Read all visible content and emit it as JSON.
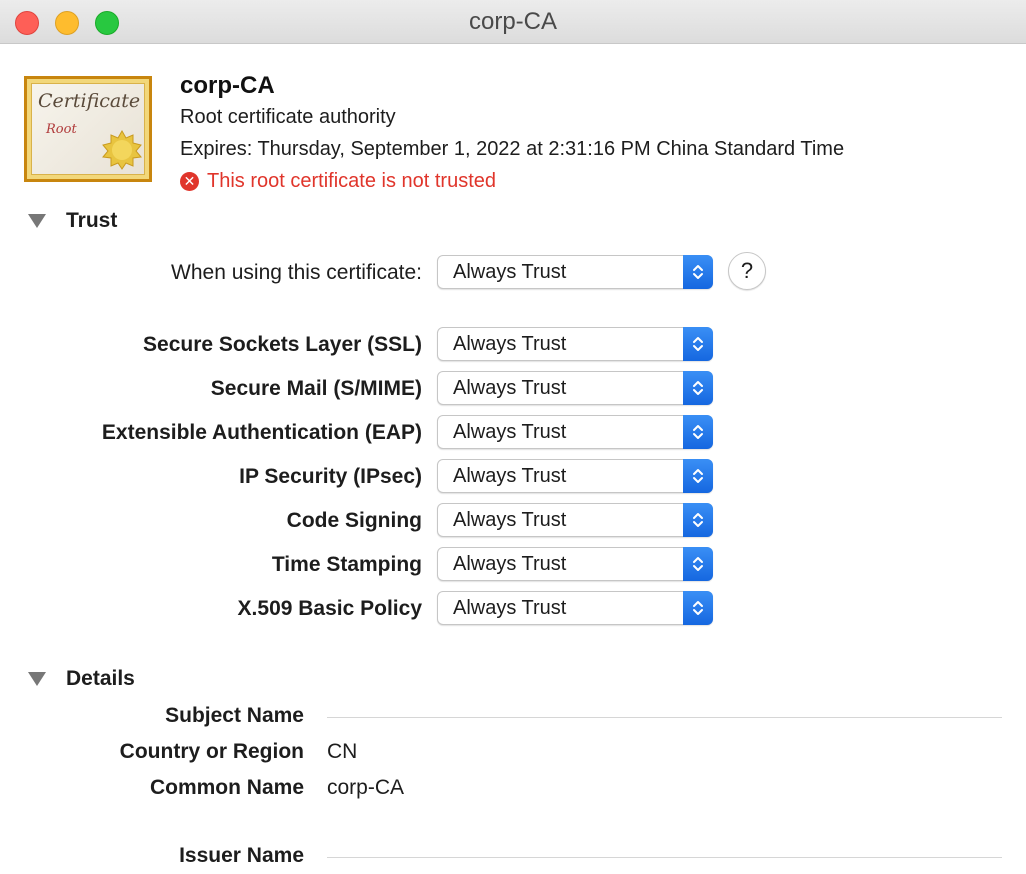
{
  "window": {
    "title": "corp-CA"
  },
  "header": {
    "name": "corp-CA",
    "subtitle": "Root certificate authority",
    "expires": "Expires: Thursday, September 1, 2022 at 2:31:16 PM China Standard Time",
    "warning": "This root certificate is not trusted",
    "warning_color": "#e0352b",
    "icon": {
      "word": "Certificate",
      "sub": "Root"
    }
  },
  "trust": {
    "section_label": "Trust",
    "when_using": {
      "label": "When using this certificate:",
      "value": "Always Trust"
    },
    "help_label": "?",
    "policies": [
      {
        "label": "Secure Sockets Layer (SSL)",
        "value": "Always Trust"
      },
      {
        "label": "Secure Mail (S/MIME)",
        "value": "Always Trust"
      },
      {
        "label": "Extensible Authentication (EAP)",
        "value": "Always Trust"
      },
      {
        "label": "IP Security (IPsec)",
        "value": "Always Trust"
      },
      {
        "label": "Code Signing",
        "value": "Always Trust"
      },
      {
        "label": "Time Stamping",
        "value": "Always Trust"
      },
      {
        "label": "X.509 Basic Policy",
        "value": "Always Trust"
      }
    ]
  },
  "details": {
    "section_label": "Details",
    "subject_name": "Subject Name",
    "country_label": "Country or Region",
    "country_value": "CN",
    "common_name_label": "Common Name",
    "common_name_value": "corp-CA",
    "issuer_name": "Issuer Name"
  },
  "colors": {
    "accent": "#1f6fe8",
    "titlebar": "#e3e3e3"
  }
}
